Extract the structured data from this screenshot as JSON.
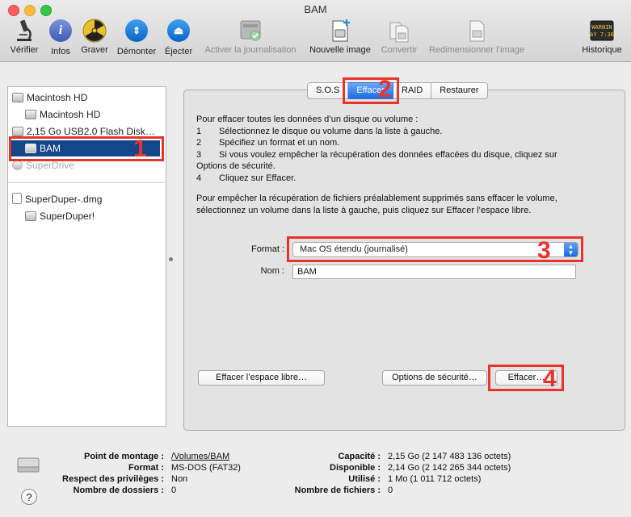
{
  "window": {
    "title": "BAM"
  },
  "toolbar": [
    {
      "id": "verifier",
      "label": "Vérifier",
      "icon": "microscope-icon",
      "enabled": true
    },
    {
      "id": "infos",
      "label": "Infos",
      "icon": "info-icon",
      "enabled": true
    },
    {
      "id": "graver",
      "label": "Graver",
      "icon": "burn-icon",
      "enabled": true
    },
    {
      "id": "demonter",
      "label": "Démonter",
      "icon": "unmount-icon",
      "enabled": true
    },
    {
      "id": "ejecter",
      "label": "Éjecter",
      "icon": "eject-icon",
      "enabled": true
    },
    {
      "id": "journal",
      "label": "Activer la journalisation",
      "icon": "journaling-icon",
      "enabled": false
    },
    {
      "id": "nouvelle",
      "label": "Nouvelle image",
      "icon": "new-image-icon",
      "enabled": true
    },
    {
      "id": "convertir",
      "label": "Convertir",
      "icon": "convert-icon",
      "enabled": false
    },
    {
      "id": "redim",
      "label": "Redimensionner l’image",
      "icon": "resize-image-icon",
      "enabled": false
    },
    {
      "id": "historique",
      "label": "Historique",
      "icon": "log-icon",
      "enabled": true,
      "icon_text": "WARNIN\nAY 7:36"
    }
  ],
  "sidebar": {
    "items": [
      {
        "label": "Macintosh HD",
        "level": 0
      },
      {
        "label": "Macintosh HD",
        "level": 1
      },
      {
        "label": "2,15 Go USB2.0 Flash Disk…",
        "level": 0
      },
      {
        "label": "BAM",
        "level": 1,
        "selected": true
      },
      {
        "label": "SuperDrive",
        "level": 0,
        "dimmed": true
      },
      {
        "label": "SuperDuper-.dmg",
        "level": 0
      },
      {
        "label": "SuperDuper!",
        "level": 1
      }
    ]
  },
  "tabs": [
    {
      "label": "S.O.S"
    },
    {
      "label": "Effacer",
      "active": true
    },
    {
      "label": "RAID"
    },
    {
      "label": "Restaurer"
    }
  ],
  "erase": {
    "intro": "Pour effacer toutes les données d’un disque ou volume :",
    "steps": [
      {
        "num": "1",
        "text": "Sélectionnez le disque ou volume dans la liste à gauche."
      },
      {
        "num": "2",
        "text": "Spécifiez un format et un nom."
      },
      {
        "num": "3",
        "text": "Si vous voulez empêcher la récupération des données effacées du disque, cliquez sur"
      },
      {
        "num": "",
        "text": "Options de sécurité."
      },
      {
        "num": "4",
        "text": "Cliquez sur Effacer."
      }
    ],
    "free_space_note_1": "Pour empêcher la récupération de fichiers préalablement supprimés sans effacer le volume,",
    "free_space_note_2": "sélectionnez un volume dans la liste à gauche, puis cliquez sur Effacer l’espace libre.",
    "format_label": "Format :",
    "format_value": "Mac OS étendu (journalisé)",
    "name_label": "Nom :",
    "name_value": "BAM",
    "btn_free_space": "Effacer l’espace libre…",
    "btn_security": "Options de sécurité…",
    "btn_erase": "Effacer…"
  },
  "annotations": [
    "1",
    "2",
    "3",
    "4"
  ],
  "info": {
    "left": [
      {
        "key": "Point de montage :",
        "value": "/Volumes/BAM",
        "link": true
      },
      {
        "key": "Format :",
        "value": "MS-DOS (FAT32)"
      },
      {
        "key": "Respect des privilèges :",
        "value": "Non"
      },
      {
        "key": "Nombre de dossiers :",
        "value": "0"
      }
    ],
    "right": [
      {
        "key": "Capacité :",
        "value": "2,15 Go (2 147 483 136 octets)"
      },
      {
        "key": "Disponible :",
        "value": "2,14 Go (2 142 265 344 octets)"
      },
      {
        "key": "Utilisé :",
        "value": "1 Mo (1 011 712 octets)"
      },
      {
        "key": "Nombre de fichiers :",
        "value": "0"
      }
    ]
  },
  "help": {
    "label": "?"
  },
  "colors": {
    "selection": "#14468a",
    "highlight": "#e8342a",
    "tab_active": "#1d6ae4"
  }
}
